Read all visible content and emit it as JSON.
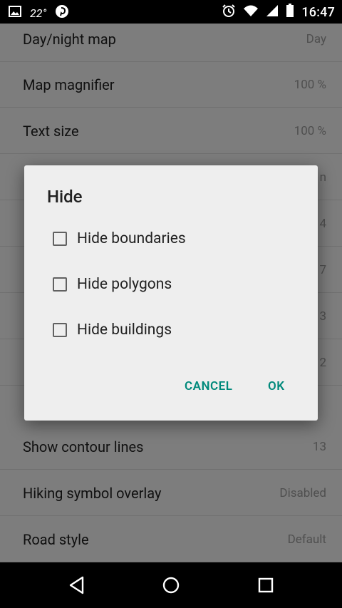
{
  "status_bar": {
    "temperature": "22°",
    "time": "16:47",
    "left_icons": [
      "image-icon",
      "pinterest-icon"
    ],
    "right_icons": [
      "alarm-icon",
      "wifi-icon",
      "cell-signal-icon",
      "battery-icon"
    ]
  },
  "settings": {
    "items": [
      {
        "title": "Day/night map",
        "value": "Day"
      },
      {
        "title": "Map magnifier",
        "value": "100 %"
      },
      {
        "title": "Text size",
        "value": "100 %"
      },
      {
        "title": "",
        "value": "n"
      },
      {
        "title": "",
        "value": "4"
      },
      {
        "title": "",
        "value": "7"
      },
      {
        "title": "",
        "value": "3"
      },
      {
        "title": "",
        "value": "2"
      },
      {
        "title": "Show contour lines",
        "value": "13"
      },
      {
        "title": "Hiking symbol overlay",
        "value": "Disabled"
      },
      {
        "title": "Road style",
        "value": "Default"
      }
    ]
  },
  "dialog": {
    "title": "Hide",
    "options": [
      {
        "label": "Hide boundaries",
        "checked": false
      },
      {
        "label": "Hide polygons",
        "checked": false
      },
      {
        "label": "Hide buildings",
        "checked": false
      }
    ],
    "cancel_label": "CANCEL",
    "ok_label": "OK",
    "accent_color": "#00897b"
  },
  "nav_bar": {
    "icons": [
      "back-icon",
      "home-icon",
      "recents-icon"
    ]
  }
}
